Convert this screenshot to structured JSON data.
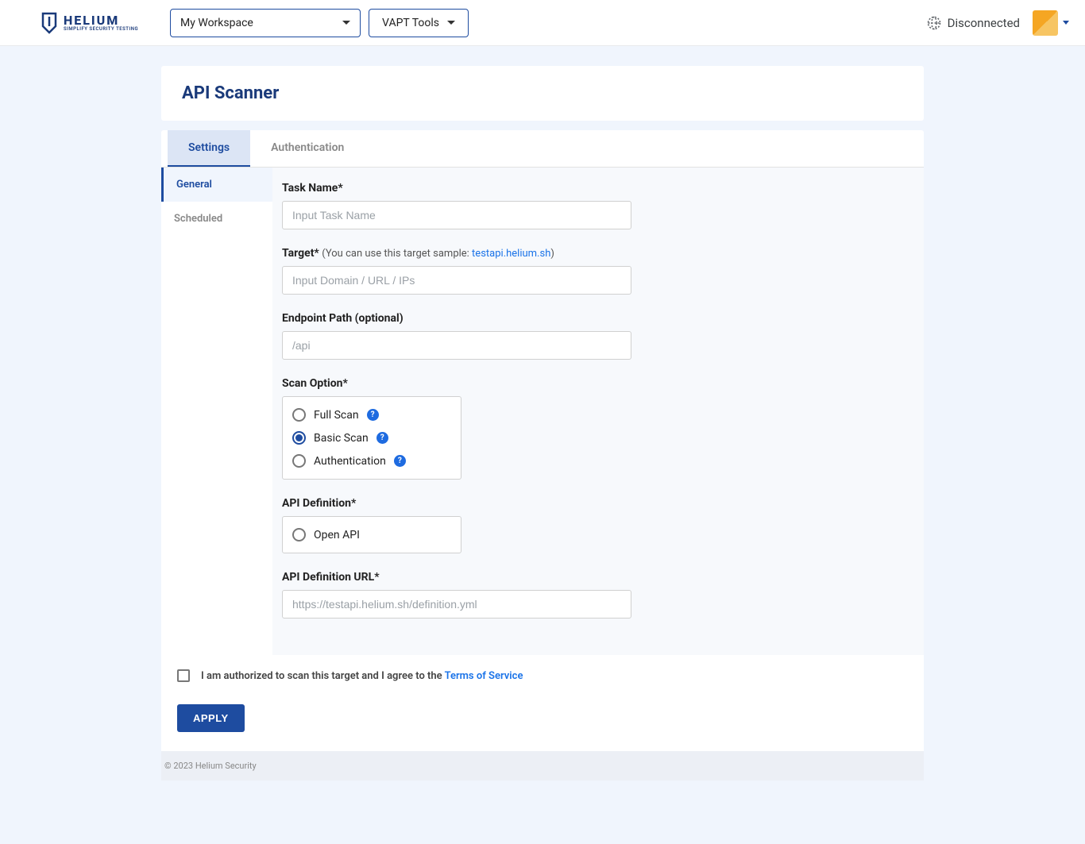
{
  "header": {
    "brand_main": "HELIUM",
    "brand_sub": "SIMPLIFY SECURITY TESTING",
    "workspace": "My Workspace",
    "tools": "VAPT Tools",
    "status": "Disconnected"
  },
  "page": {
    "title": "API Scanner"
  },
  "tabs": {
    "settings": "Settings",
    "authentication": "Authentication"
  },
  "sidenav": {
    "general": "General",
    "scheduled": "Scheduled"
  },
  "form": {
    "task_name_label": "Task Name*",
    "task_name_placeholder": "Input Task Name",
    "target_label": "Target*",
    "target_hint_prefix": "(You can use this target sample: ",
    "target_hint_link": "testapi.helium.sh",
    "target_hint_suffix": ")",
    "target_placeholder": "Input Domain / URL / IPs",
    "endpoint_label": "Endpoint Path (optional)",
    "endpoint_placeholder": "/api",
    "scan_option_label": "Scan Option*",
    "scan_options": {
      "full": "Full Scan",
      "basic": "Basic Scan",
      "auth": "Authentication"
    },
    "api_def_label": "API Definition*",
    "api_def_option": "Open API",
    "api_def_url_label": "API Definition URL*",
    "api_def_url_placeholder": "https://testapi.helium.sh/definition.yml"
  },
  "consent": {
    "prefix": "I am authorized to scan this target and I agree to the ",
    "link": "Terms of Service"
  },
  "actions": {
    "apply": "APPLY"
  },
  "footer": {
    "text": "© 2023 Helium Security"
  }
}
